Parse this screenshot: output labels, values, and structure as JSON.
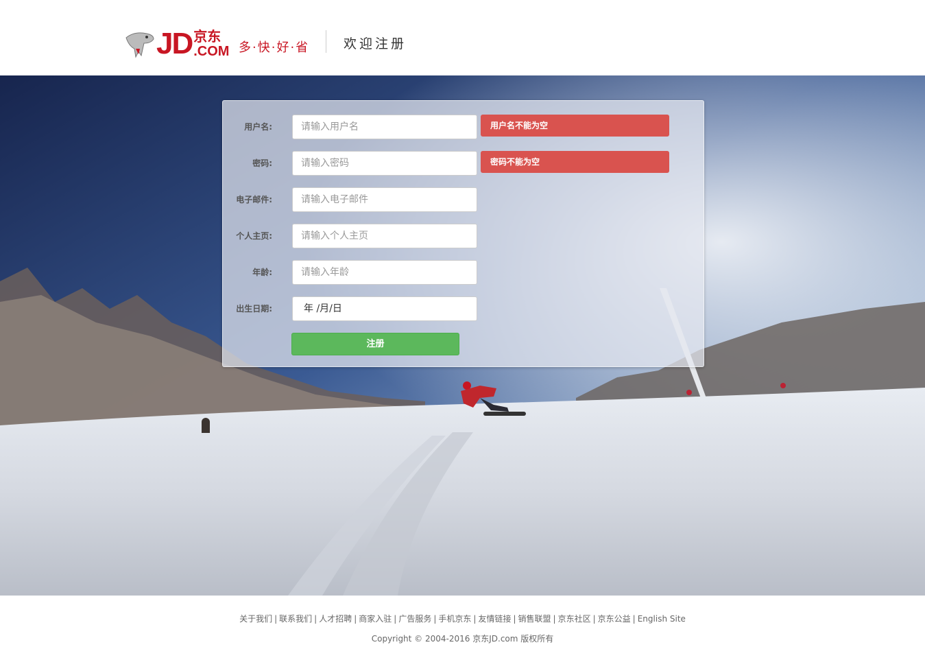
{
  "colors": {
    "brand": "#c81623",
    "error": "#d9534f",
    "submit": "#5cb85c"
  },
  "header": {
    "logo_text": "JD",
    "logo_cn": "京东",
    "logo_com": ".COM",
    "slogan": "多·快·好·省",
    "welcome": "欢迎注册"
  },
  "form": {
    "fields": [
      {
        "label": "用户名:",
        "placeholder": "请输入用户名",
        "error": "用户名不能为空"
      },
      {
        "label": "密码:",
        "placeholder": "请输入密码",
        "error": "密码不能为空"
      },
      {
        "label": "电子邮件:",
        "placeholder": "请输入电子邮件"
      },
      {
        "label": "个人主页:",
        "placeholder": "请输入个人主页"
      },
      {
        "label": "年龄:",
        "placeholder": "请输入年龄"
      },
      {
        "label": "出生日期:",
        "date_placeholder": "年 /月/日"
      }
    ],
    "submit_label": "注册"
  },
  "footer": {
    "links": [
      "关于我们",
      "联系我们",
      "人才招聘",
      "商家入驻",
      "广告服务",
      "手机京东",
      "友情链接",
      "销售联盟",
      "京东社区",
      "京东公益",
      "English Site"
    ],
    "separator": "|",
    "copyright": "Copyright © 2004-2016  京东JD.com 版权所有"
  }
}
